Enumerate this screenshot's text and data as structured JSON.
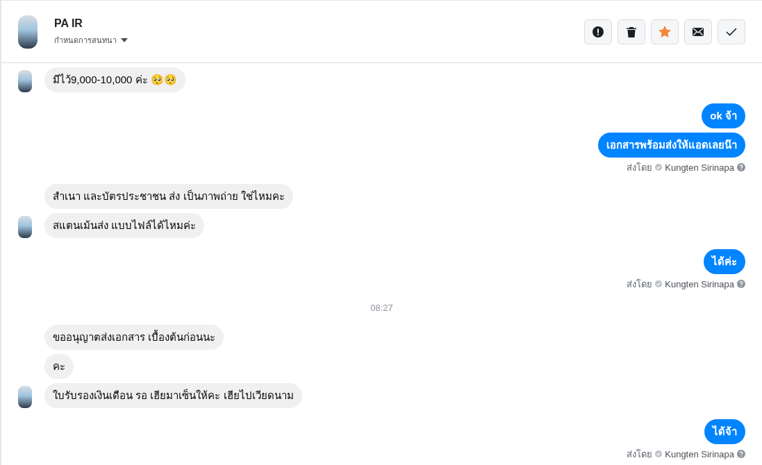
{
  "header": {
    "name": "PA IR",
    "subtitle": "กำหนดการสนทนา",
    "actions": [
      {
        "kind": "alert",
        "on": false
      },
      {
        "kind": "trash",
        "on": false
      },
      {
        "kind": "star",
        "on": true
      },
      {
        "kind": "mail",
        "on": false
      },
      {
        "kind": "check",
        "on": false
      }
    ]
  },
  "messages": [
    {
      "kind": "incoming",
      "text": "มีไว้9,000-10,000 ค่ะ 🥺🥺",
      "avatar": true
    },
    {
      "kind": "outgoing",
      "text": "ok จ้า"
    },
    {
      "kind": "outgoing",
      "text": "เอกสารพร้อมส่งให้แอดเลยน๊า"
    },
    {
      "kind": "sent_by",
      "label": "ส่งโดย",
      "sender": "Kungten Sirinapa"
    },
    {
      "kind": "incoming",
      "text": "สำเนา และบัตรประชาชน ส่ง เป็นภาพถ่าย ใช่ไหมคะ",
      "avatar": false
    },
    {
      "kind": "incoming",
      "text": "สแตนเม้นส่ง แบบไฟล์ได้ไหมค่ะ",
      "avatar": true
    },
    {
      "kind": "outgoing",
      "text": "ได้ค่ะ"
    },
    {
      "kind": "sent_by",
      "label": "ส่งโดย",
      "sender": "Kungten Sirinapa"
    },
    {
      "kind": "time",
      "text": "08:27"
    },
    {
      "kind": "incoming",
      "text": "ขออนุญาตส่งเอกสาร เบื้องต้นก่อนนะ",
      "avatar": false
    },
    {
      "kind": "incoming",
      "text": "คะ",
      "avatar": false
    },
    {
      "kind": "incoming",
      "text": "ใบรับรองเงินเดือน รอ เฮียมาเซ็นให้คะ เฮียไปเวียดนาม",
      "avatar": true
    },
    {
      "kind": "outgoing",
      "text": "ได้จ้า"
    },
    {
      "kind": "sent_by",
      "label": "ส่งโดย",
      "sender": "Kungten Sirinapa"
    }
  ]
}
